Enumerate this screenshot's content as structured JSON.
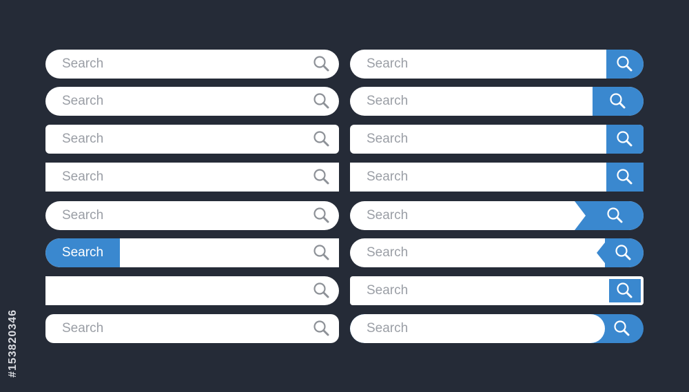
{
  "placeholder": "Search",
  "active_tag_label": "Search",
  "icon": "magnifier-icon",
  "colors": {
    "background": "#252b37",
    "bar": "#ffffff",
    "placeholder_text": "#9a9ea5",
    "accent": "#3a88cf",
    "icon_gray": "#8d9197"
  },
  "side_text": "#153820346"
}
